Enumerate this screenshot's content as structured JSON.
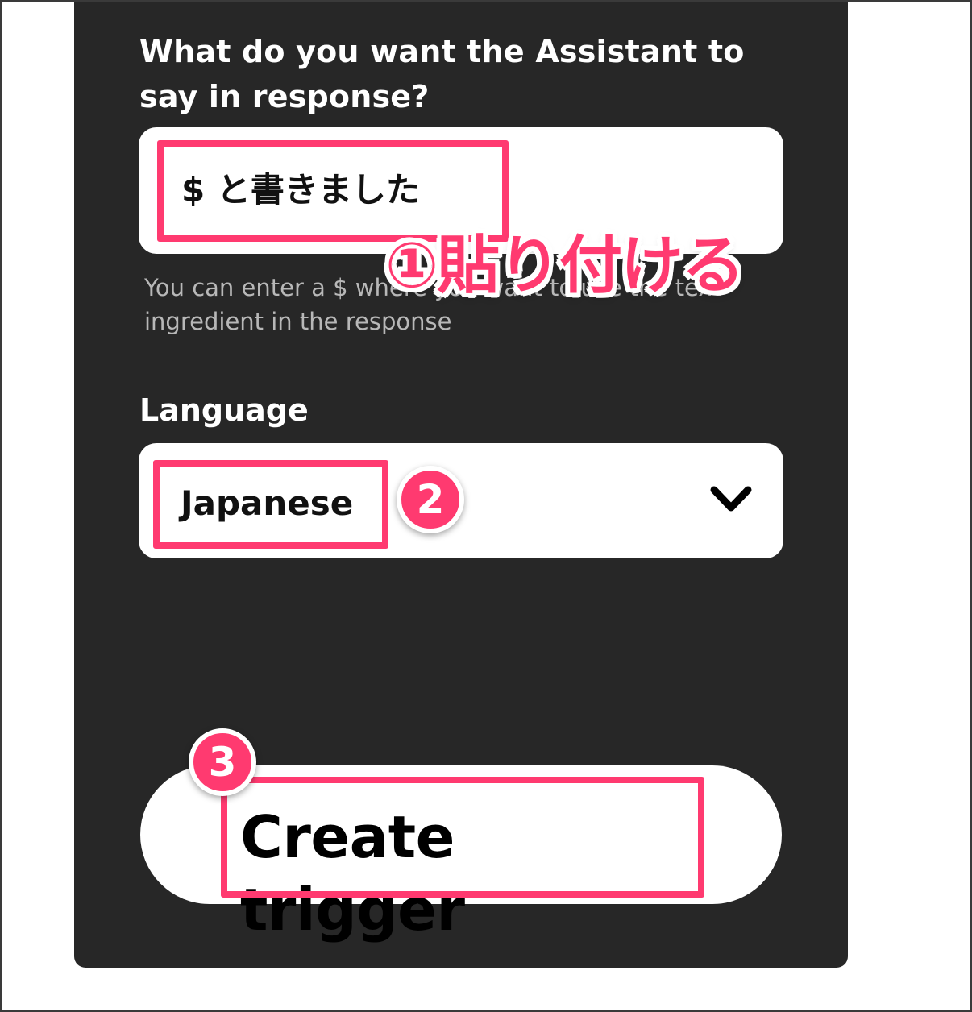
{
  "form": {
    "prompt_label": "What do you want the Assistant to say in response?",
    "response_value": "$ と書きました",
    "help_text": "You can enter a $ where you want to use the text ingredient in the response",
    "language_label": "Language",
    "language_value": "Japanese",
    "chevron_icon": "chevron-down-icon",
    "create_button_label": "Create trigger"
  },
  "annotations": {
    "step1_text": "①貼り付ける",
    "step2_badge": "2",
    "step3_badge": "3",
    "highlight_color": "#ff3a70"
  },
  "colors": {
    "panel_bg": "#272727",
    "field_bg": "#ffffff",
    "accent": "#ff3a70"
  }
}
